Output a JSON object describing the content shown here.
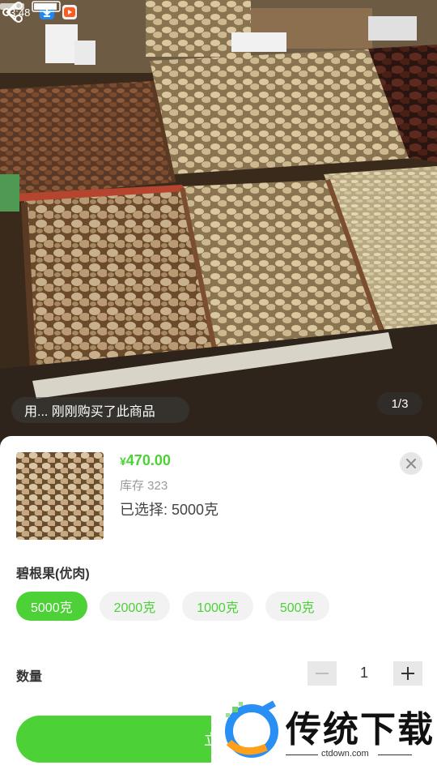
{
  "status_bar": {
    "time": "3:48",
    "icons": [
      "download-app-icon",
      "video-app-icon"
    ]
  },
  "nav": {
    "back_icon": "chevron-left-icon",
    "share_icon": "share-icon"
  },
  "gallery": {
    "purchase_ticker": "用... 刚刚购买了此商品",
    "counter": "1/3"
  },
  "sku_sheet": {
    "price_currency": "¥",
    "price_value": "470.00",
    "stock_text": "库存 323",
    "selected_text": "已选择: 5000克",
    "close_icon": "close-icon",
    "spec_title": "碧根果(优肉)",
    "spec_options": [
      {
        "label": "5000克",
        "selected": true
      },
      {
        "label": "2000克",
        "selected": false
      },
      {
        "label": "1000克",
        "selected": false
      },
      {
        "label": "500克",
        "selected": false
      }
    ],
    "quantity_label": "数量",
    "quantity_value": "1",
    "buy_label": "立即"
  },
  "watermark": {
    "title": "传统下载",
    "url": "ctdown.com"
  },
  "colors": {
    "accent": "#4cd137",
    "sheet_bg": "#ffffff",
    "chip_bg": "#f2f2f2"
  }
}
